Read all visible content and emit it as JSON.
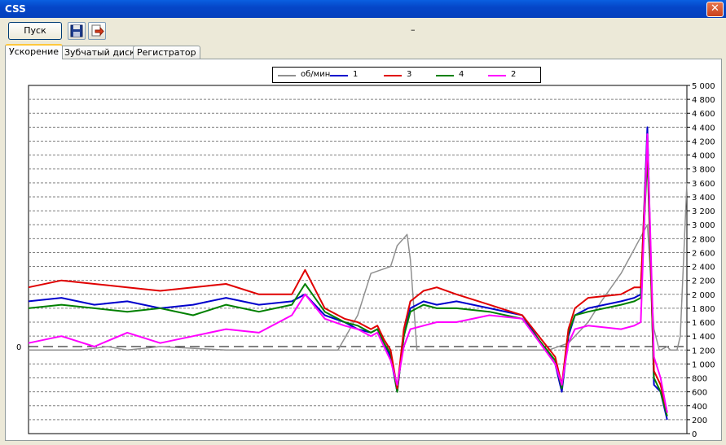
{
  "window": {
    "title": "CSS",
    "close_glyph": "✕"
  },
  "toolbar": {
    "start_label": "Пуск",
    "save_icon": "floppy-disk-icon",
    "export_icon": "export-icon",
    "status_text": "–"
  },
  "tabs": [
    {
      "label": "Ускорение",
      "active": true
    },
    {
      "label": "Зубчатый диск",
      "active": false
    },
    {
      "label": "Регистратор",
      "active": false
    }
  ],
  "colors": {
    "rpm": "#909090",
    "s1": "#0000cc",
    "s3": "#e00000",
    "s4": "#008000",
    "s2": "#ff00ff",
    "grid": "#808080"
  },
  "chart_data": {
    "type": "line",
    "legend": [
      {
        "name": "об/мин",
        "color": "#909090"
      },
      {
        "name": "1",
        "color": "#0000cc"
      },
      {
        "name": "3",
        "color": "#e00000"
      },
      {
        "name": "4",
        "color": "#008000"
      },
      {
        "name": "2",
        "color": "#ff00ff"
      }
    ],
    "legend_placement": "top",
    "grid": true,
    "y_right": {
      "ylim": [
        0,
        5000
      ],
      "ticks": [
        "0",
        "200",
        "400",
        "600",
        "800",
        "1 000",
        "1 200",
        "1 400",
        "1 600",
        "1 800",
        "2 000",
        "2 200",
        "2 400",
        "2 600",
        "2 800",
        "3 000",
        "3 200",
        "3 400",
        "3 600",
        "3 800",
        "4 000",
        "4 200",
        "4 400",
        "4 600",
        "4 800",
        "5 000"
      ]
    },
    "y_left": {
      "zero_label": "0"
    },
    "xlim": [
      0,
      100
    ],
    "series": [
      {
        "name": "об/мин",
        "axis": "right",
        "x": [
          0,
          8,
          12,
          15,
          20,
          30,
          40,
          47,
          50,
          52,
          55,
          56,
          57.5,
          58,
          59,
          60,
          62,
          65,
          70,
          75,
          79,
          82,
          85,
          87,
          90,
          92,
          94,
          95,
          95.8,
          96,
          97,
          97.5,
          98,
          98.5,
          99,
          100
        ],
        "y": [
          1200,
          1200,
          1250,
          1200,
          1250,
          1200,
          1200,
          1200,
          1700,
          2300,
          2400,
          2700,
          2860,
          2500,
          1200,
          1200,
          1200,
          1200,
          1200,
          1200,
          1200,
          1300,
          1600,
          1900,
          2300,
          2650,
          3000,
          1500,
          1200,
          1200,
          1250,
          1200,
          1200,
          1200,
          1400,
          3600
        ]
      },
      {
        "name": "1",
        "axis": "right",
        "x": [
          0,
          5,
          10,
          15,
          20,
          25,
          30,
          35,
          40,
          42,
          45,
          48,
          50,
          52,
          53,
          54,
          55,
          56,
          57,
          58,
          60,
          62,
          65,
          70,
          75,
          80,
          81,
          82,
          83,
          85,
          90,
          92,
          93,
          94,
          95,
          96,
          97
        ],
        "y": [
          1900,
          1950,
          1850,
          1900,
          1800,
          1850,
          1950,
          1850,
          1900,
          2000,
          1700,
          1600,
          1500,
          1450,
          1500,
          1300,
          1100,
          600,
          1400,
          1800,
          1900,
          1850,
          1900,
          1800,
          1700,
          1000,
          600,
          1400,
          1700,
          1800,
          1900,
          1950,
          2000,
          4400,
          700,
          600,
          200
        ]
      },
      {
        "name": "3",
        "axis": "right",
        "x": [
          0,
          5,
          10,
          15,
          20,
          25,
          30,
          35,
          40,
          42,
          45,
          48,
          50,
          52,
          53,
          54,
          55,
          56,
          57,
          58,
          60,
          62,
          65,
          70,
          75,
          80,
          81,
          82,
          83,
          85,
          90,
          92,
          93,
          94,
          95,
          96,
          97
        ],
        "y": [
          2100,
          2200,
          2150,
          2100,
          2050,
          2100,
          2150,
          2000,
          2000,
          2350,
          1800,
          1650,
          1600,
          1500,
          1550,
          1350,
          1200,
          650,
          1500,
          1900,
          2050,
          2100,
          2000,
          1850,
          1700,
          1100,
          700,
          1500,
          1800,
          1950,
          2000,
          2100,
          2100,
          4200,
          900,
          700,
          300
        ]
      },
      {
        "name": "4",
        "axis": "right",
        "x": [
          0,
          5,
          10,
          15,
          20,
          25,
          30,
          35,
          40,
          42,
          45,
          48,
          50,
          52,
          53,
          54,
          55,
          56,
          57,
          58,
          60,
          62,
          65,
          70,
          75,
          80,
          81,
          82,
          83,
          85,
          90,
          92,
          93,
          94,
          95,
          96,
          97
        ],
        "y": [
          1800,
          1850,
          1800,
          1750,
          1800,
          1700,
          1850,
          1750,
          1850,
          2150,
          1750,
          1600,
          1550,
          1450,
          1500,
          1300,
          1150,
          600,
          1400,
          1750,
          1850,
          1800,
          1800,
          1750,
          1650,
          1050,
          650,
          1450,
          1700,
          1750,
          1850,
          1900,
          1950,
          4000,
          800,
          600,
          250
        ]
      },
      {
        "name": "2",
        "axis": "right",
        "x": [
          0,
          5,
          10,
          15,
          20,
          25,
          30,
          35,
          40,
          42,
          45,
          48,
          50,
          52,
          53,
          54,
          55,
          56,
          57,
          58,
          60,
          62,
          65,
          70,
          75,
          80,
          81,
          82,
          83,
          85,
          90,
          92,
          93,
          94,
          95,
          96,
          97
        ],
        "y": [
          1300,
          1400,
          1250,
          1450,
          1300,
          1400,
          1500,
          1450,
          1700,
          2000,
          1650,
          1550,
          1500,
          1400,
          1450,
          1250,
          1050,
          700,
          1250,
          1500,
          1550,
          1600,
          1600,
          1700,
          1650,
          1000,
          700,
          1300,
          1500,
          1550,
          1500,
          1550,
          1600,
          4300,
          1100,
          800,
          300
        ]
      }
    ]
  }
}
